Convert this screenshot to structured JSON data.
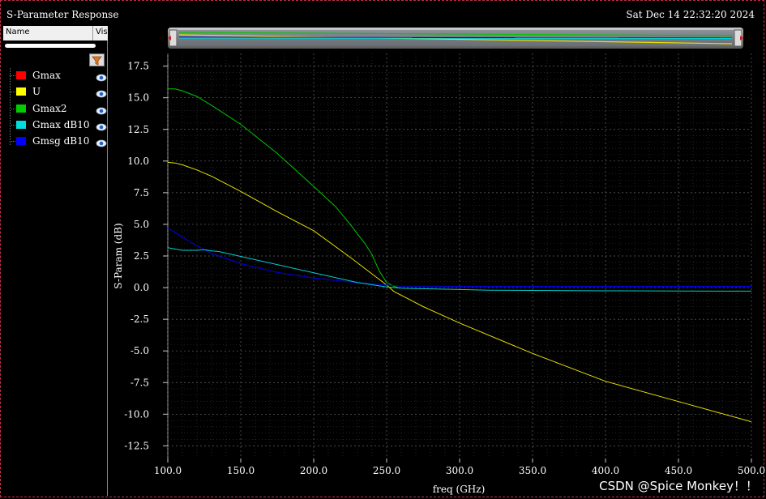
{
  "window": {
    "title": "S-Parameter Response",
    "datetime": "Sat Dec 14 22:32:20 2024"
  },
  "sidebar": {
    "header_name": "Name",
    "header_vis": "Vis",
    "filter_icon": "funnel-icon",
    "items": [
      {
        "label": "Gmax",
        "color": "#ff0000",
        "icon": "eye-icon"
      },
      {
        "label": "U",
        "color": "#ffff00",
        "icon": "eye-icon"
      },
      {
        "label": "Gmax2",
        "color": "#00cc00",
        "icon": "eye-icon"
      },
      {
        "label": "Gmax dB10",
        "color": "#00dddd",
        "icon": "eye-icon"
      },
      {
        "label": "Gmsg dB10",
        "color": "#0000ff",
        "icon": "eye-icon"
      }
    ]
  },
  "watermark": "CSDN @Spice Monkey！！",
  "chart_data": {
    "type": "line",
    "xlabel": "freq (GHz)",
    "ylabel": "S-Param (dB)",
    "xlim": [
      100,
      500
    ],
    "ylim": [
      -13.5,
      18.5
    ],
    "xticks": [
      "100.0",
      "150.0",
      "200.0",
      "250.0",
      "300.0",
      "350.0",
      "400.0",
      "450.0",
      "500.0"
    ],
    "yticks": [
      "17.5",
      "15.0",
      "12.5",
      "10.0",
      "7.5",
      "5.0",
      "2.5",
      "0.0",
      "-2.5",
      "-5.0",
      "-7.5",
      "-10.0",
      "-12.5"
    ],
    "grid": true,
    "background": "#000000",
    "series": [
      {
        "name": "U",
        "color": "#e8e000",
        "x": [
          100,
          105,
          110,
          120,
          130,
          150,
          175,
          200,
          225,
          250,
          255,
          275,
          300,
          350,
          400,
          450,
          500
        ],
        "y": [
          9.9,
          9.85,
          9.7,
          9.3,
          8.8,
          7.6,
          6.0,
          4.5,
          2.4,
          0.2,
          -0.3,
          -1.5,
          -2.8,
          -5.2,
          -7.4,
          -9.0,
          -10.6
        ]
      },
      {
        "name": "Gmax2",
        "color": "#00c800",
        "x": [
          100,
          105,
          110,
          120,
          130,
          150,
          175,
          200,
          215,
          225,
          235,
          240,
          245,
          250,
          255,
          258
        ],
        "y": [
          15.7,
          15.7,
          15.55,
          15.1,
          14.4,
          12.9,
          10.6,
          8.0,
          6.4,
          5.0,
          3.5,
          2.6,
          1.3,
          0.4,
          0.1,
          0.0
        ]
      },
      {
        "name": "Gmsg dB10",
        "color": "#0000ee",
        "x": [
          100,
          110,
          120,
          130,
          150,
          175,
          200,
          225,
          250,
          260,
          300,
          350,
          400,
          450,
          500
        ],
        "y": [
          4.7,
          4.0,
          3.3,
          2.7,
          1.9,
          1.2,
          0.75,
          0.45,
          0.2,
          0.12,
          0.1,
          0.1,
          0.1,
          0.1,
          0.1
        ]
      },
      {
        "name": "Gmax dB10",
        "color": "#00d0d0",
        "x": [
          100,
          110,
          120,
          125,
          130,
          135,
          230,
          250,
          260,
          300,
          320,
          350,
          400,
          450,
          500
        ],
        "y": [
          3.15,
          2.95,
          2.95,
          3.0,
          2.9,
          2.85,
          0.4,
          0.05,
          -0.05,
          -0.15,
          -0.2,
          -0.22,
          -0.25,
          -0.27,
          -0.28
        ]
      }
    ],
    "overview": {
      "series": [
        {
          "color": "#e8e000",
          "y": [
            0.3,
            0.85
          ]
        },
        {
          "color": "#00c800",
          "y": [
            0.15,
            0.35
          ]
        },
        {
          "color": "#0000ee",
          "y": [
            0.45,
            0.5
          ]
        },
        {
          "color": "#00d0d0",
          "y": [
            0.5,
            0.52
          ]
        }
      ]
    }
  }
}
